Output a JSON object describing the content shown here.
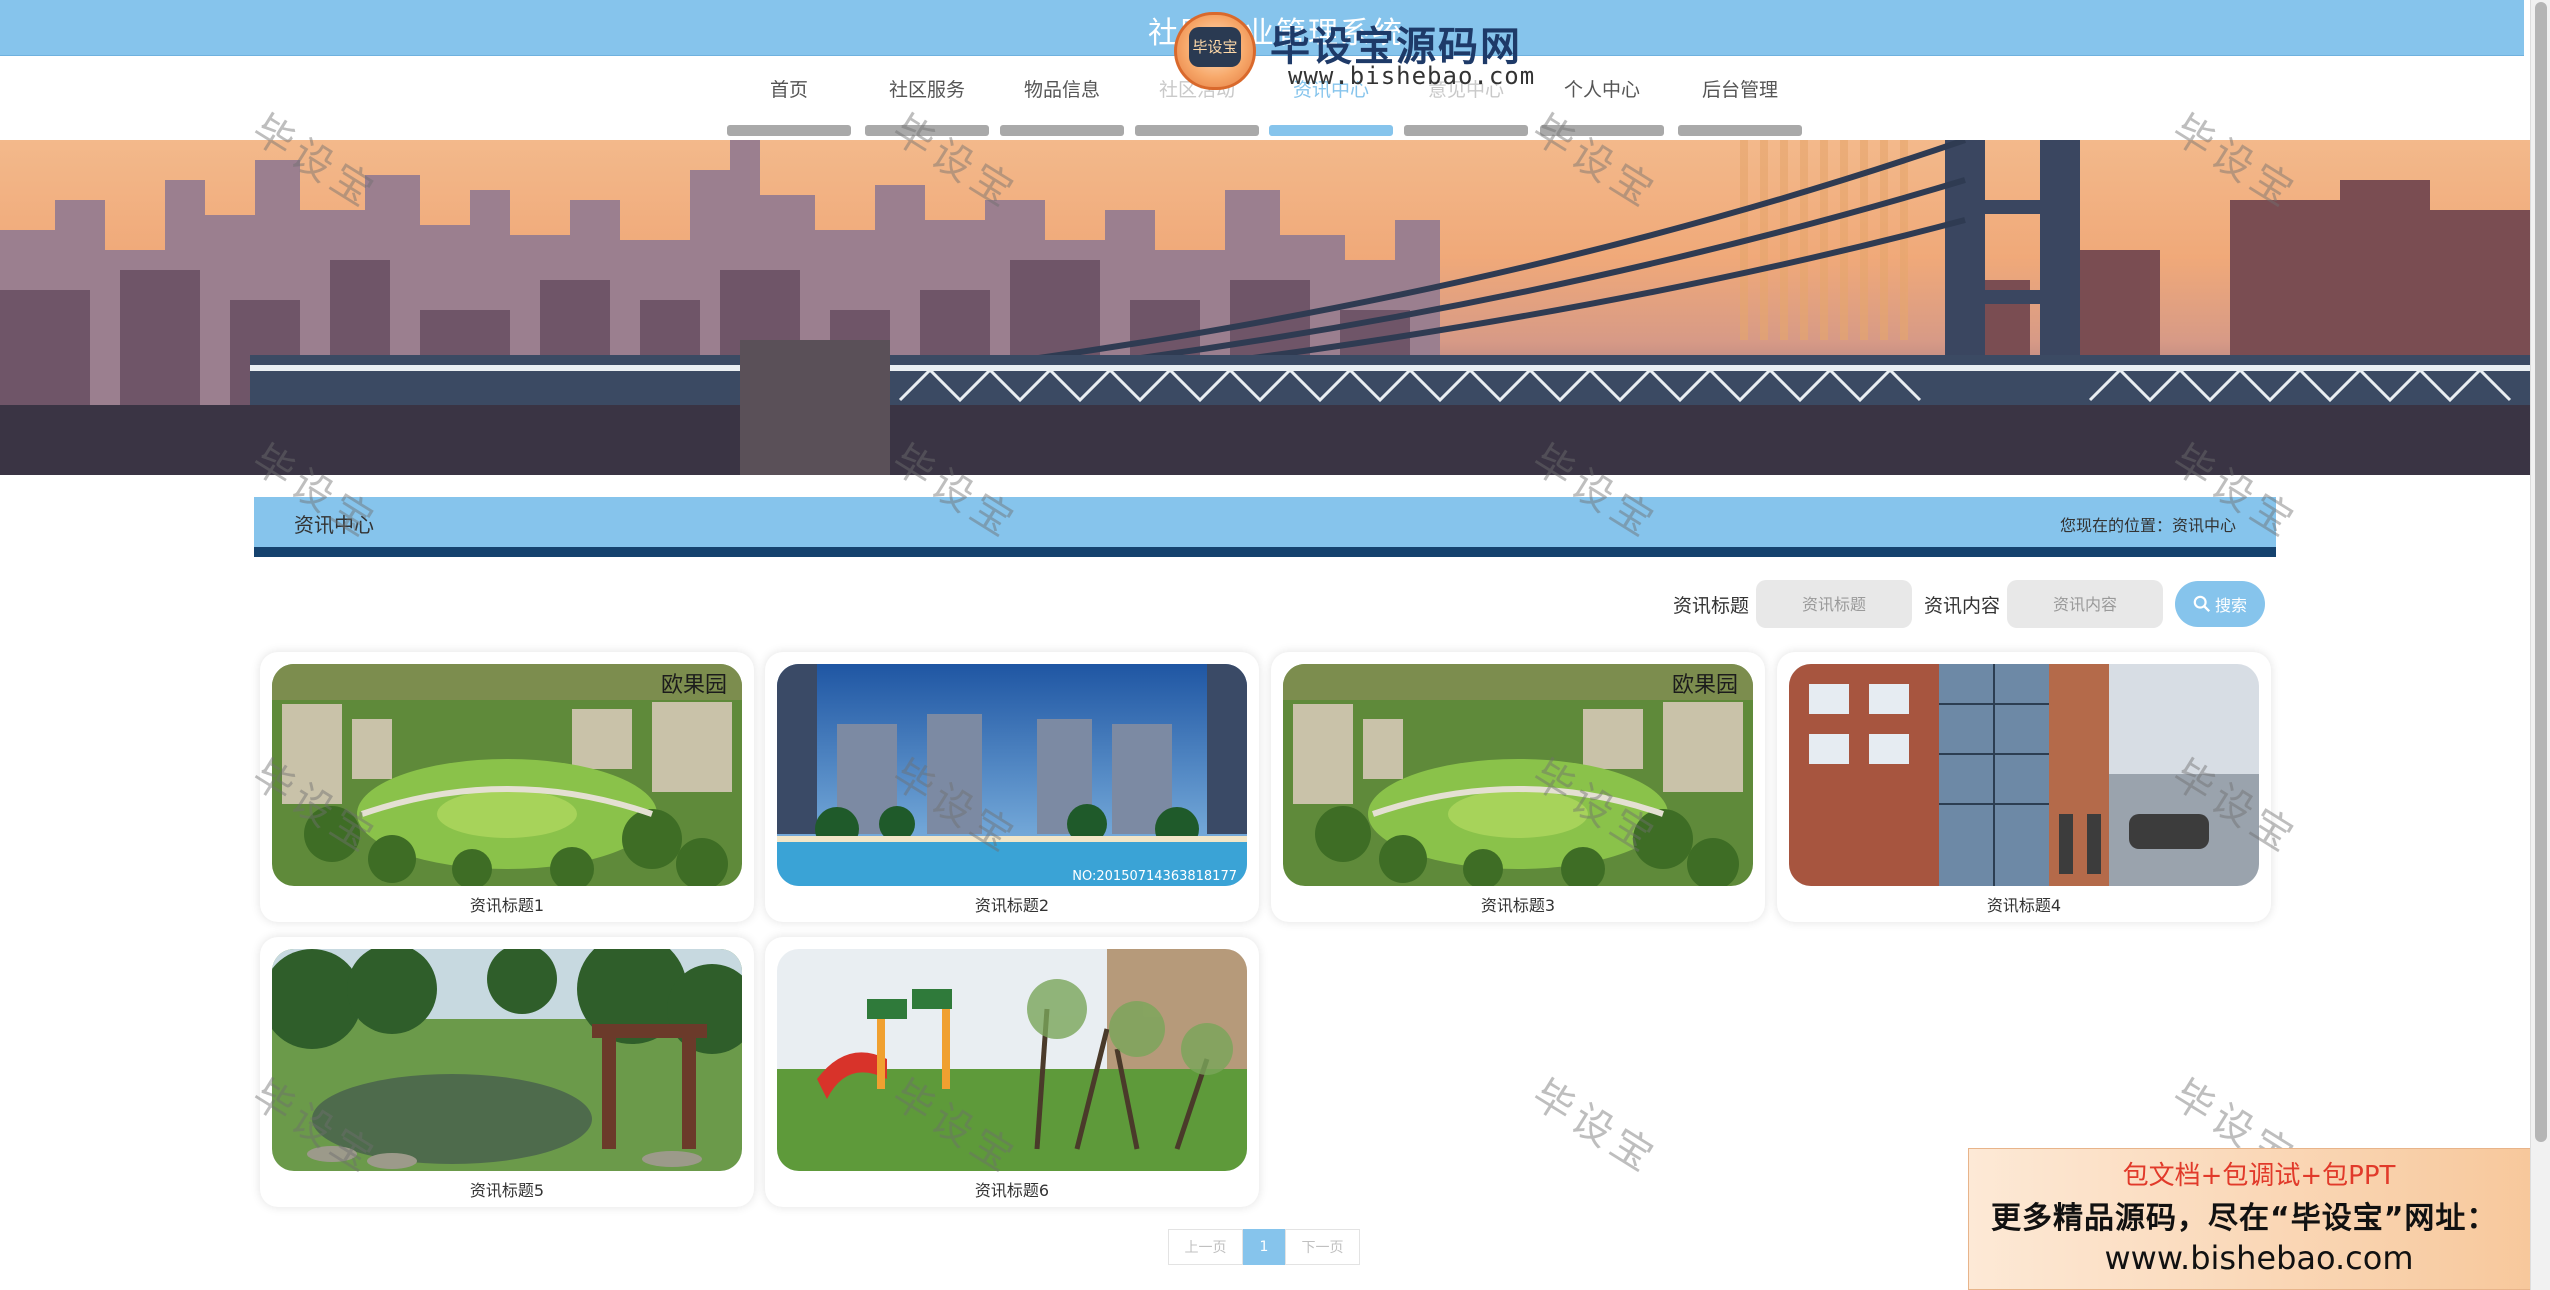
{
  "header": {
    "site_title": "社区物业管理系统"
  },
  "watermark_logo": {
    "badge_text": "毕设宝",
    "name": "毕设宝源码网",
    "url": "www.bishebao.com"
  },
  "nav": {
    "items": [
      {
        "label": "首页",
        "state": "normal"
      },
      {
        "label": "社区服务",
        "state": "normal"
      },
      {
        "label": "物品信息",
        "state": "normal"
      },
      {
        "label": "社区活动",
        "state": "faded"
      },
      {
        "label": "资讯中心",
        "state": "active"
      },
      {
        "label": "意见中心",
        "state": "faded"
      },
      {
        "label": "个人中心",
        "state": "normal"
      },
      {
        "label": "后台管理",
        "state": "normal"
      }
    ]
  },
  "section": {
    "title": "资讯中心",
    "breadcrumb": "您现在的位置：资讯中心"
  },
  "search": {
    "title_label": "资讯标题",
    "title_placeholder": "资讯标题",
    "content_label": "资讯内容",
    "content_placeholder": "资讯内容",
    "button_label": "搜索"
  },
  "cards": [
    {
      "caption": "资讯标题1",
      "image": "garden-aerial",
      "overlay_text": "欧果园"
    },
    {
      "caption": "资讯标题2",
      "image": "pool-towers-night",
      "overlay_text": "NO:20150714363818177"
    },
    {
      "caption": "资讯标题3",
      "image": "garden-aerial",
      "overlay_text": "欧果园"
    },
    {
      "caption": "资讯标题4",
      "image": "elevator-building",
      "overlay_text": ""
    },
    {
      "caption": "资讯标题5",
      "image": "park-pond",
      "overlay_text": ""
    },
    {
      "caption": "资讯标题6",
      "image": "playground",
      "overlay_text": ""
    }
  ],
  "pagination": {
    "prev_label": "上一页",
    "current": "1",
    "next_label": "下一页"
  },
  "watermark_text": "毕设宝",
  "ad": {
    "line1": "包文档+包调试+包PPT",
    "line2": "更多精品源码，尽在“毕设宝”网址：",
    "line3": "www.bishebao.com"
  },
  "colors": {
    "accent": "#86c4ec",
    "section_border": "#15426e",
    "nav_bar": "#a9a9a9"
  }
}
